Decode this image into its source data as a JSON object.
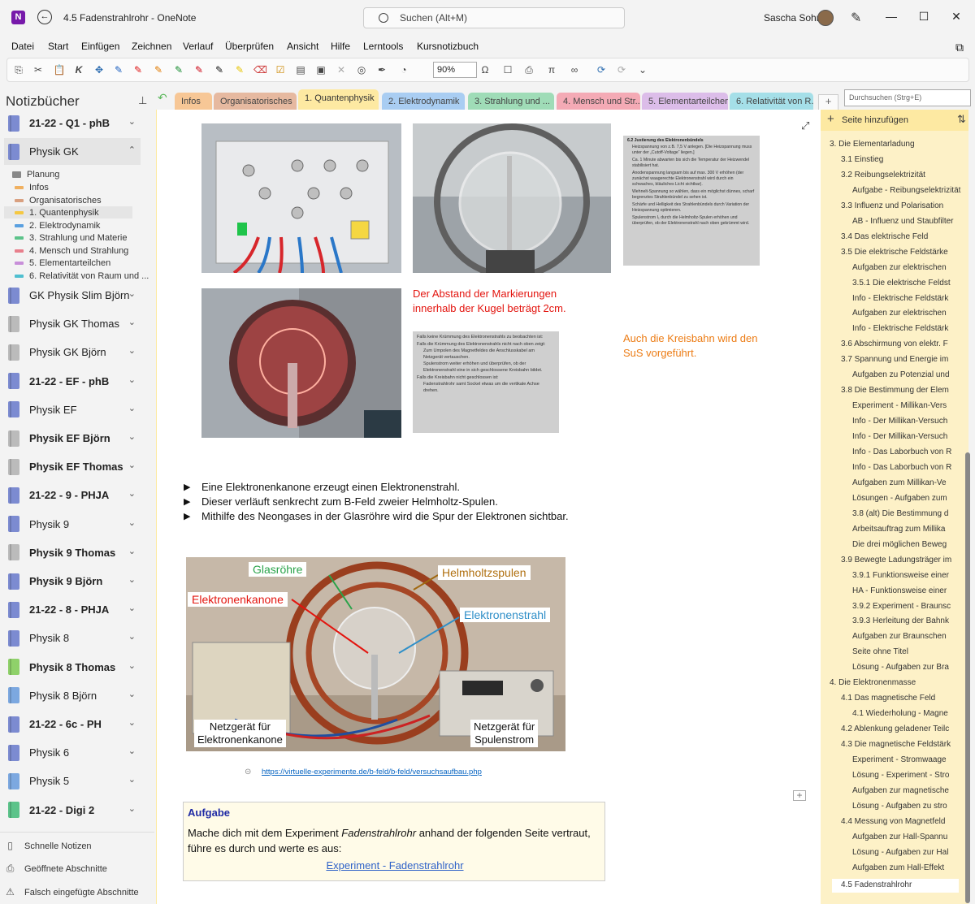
{
  "window": {
    "title": "4.5 Fadenstrahlrohr  -  OneNote",
    "search_placeholder": "Suchen (Alt+M)",
    "user": "Sascha Sohn"
  },
  "menu": [
    "Datei",
    "Start",
    "Einfügen",
    "Zeichnen",
    "Verlauf",
    "Überprüfen",
    "Ansicht",
    "Hilfe",
    "Lerntools",
    "Kursnotizbuch"
  ],
  "ribbon": {
    "zoom": "90%"
  },
  "sidebar": {
    "heading": "Notizbücher",
    "notebooks_top": [
      {
        "name": "21-22 - Q1 - phB",
        "bold": true,
        "color": "#7c8bd1"
      },
      {
        "name": "Physik GK",
        "bold": false,
        "color": "#7c8bd1",
        "expanded": true
      }
    ],
    "sections": [
      {
        "name": "Planung",
        "color": "#888"
      },
      {
        "name": "Infos",
        "color": "#f0b060"
      },
      {
        "name": "Organisatorisches",
        "color": "#d9a080"
      },
      {
        "name": "1. Quantenphysik",
        "color": "#f5c842"
      },
      {
        "name": "2. Elektrodynamik",
        "color": "#5aa0e0"
      },
      {
        "name": "3. Strahlung und Materie",
        "color": "#5cc38a"
      },
      {
        "name": "4. Mensch und Strahlung",
        "color": "#e87f8c"
      },
      {
        "name": "5. Elementarteilchen",
        "color": "#c88fd9"
      },
      {
        "name": "6. Relativität von Raum und ...",
        "color": "#4fbfd0"
      }
    ],
    "notebooks_bottom": [
      {
        "name": "GK Physik Slim Björn",
        "bold": false,
        "color": "#7c8bd1"
      },
      {
        "name": "Physik GK Thomas",
        "bold": false,
        "color": "#bbb"
      },
      {
        "name": "Physik GK Björn",
        "bold": false,
        "color": "#bbb"
      },
      {
        "name": "21-22 - EF - phB",
        "bold": true,
        "color": "#7c8bd1"
      },
      {
        "name": "Physik EF",
        "bold": false,
        "color": "#7c8bd1"
      },
      {
        "name": "Physik EF Björn",
        "bold": true,
        "color": "#bbb"
      },
      {
        "name": "Physik EF Thomas",
        "bold": true,
        "color": "#bbb"
      },
      {
        "name": "21-22 - 9 - PHJA",
        "bold": true,
        "color": "#7c8bd1"
      },
      {
        "name": "Physik 9",
        "bold": false,
        "color": "#7c8bd1"
      },
      {
        "name": "Physik 9 Thomas",
        "bold": true,
        "color": "#bbb"
      },
      {
        "name": "Physik 9 Björn",
        "bold": true,
        "color": "#7c8bd1"
      },
      {
        "name": "21-22 - 8 - PHJA",
        "bold": true,
        "color": "#7c8bd1"
      },
      {
        "name": "Physik 8",
        "bold": false,
        "color": "#7c8bd1"
      },
      {
        "name": "Physik 8 Thomas",
        "bold": true,
        "color": "#8fd16a"
      },
      {
        "name": "Physik 8 Björn",
        "bold": false,
        "color": "#7ca8e0"
      },
      {
        "name": "21-22 - 6c - PH",
        "bold": true,
        "color": "#7c8bd1"
      },
      {
        "name": "Physik 6",
        "bold": false,
        "color": "#7c8bd1"
      },
      {
        "name": "Physik 5",
        "bold": false,
        "color": "#7ca8e0"
      },
      {
        "name": "21-22 - Digi 2",
        "bold": true,
        "color": "#5cc38a"
      }
    ],
    "bottom_links": [
      "Schnelle Notizen",
      "Geöffnete Abschnitte",
      "Falsch eingefügte Abschnitte"
    ]
  },
  "section_tabs": [
    {
      "label": "Infos",
      "color": "#f7c796"
    },
    {
      "label": "Organisatorisches",
      "color": "#e6b9a0"
    },
    {
      "label": "1. Quantenphysik",
      "color": "#fde9a2"
    },
    {
      "label": "2. Elektrodynamik",
      "color": "#a9cdf2"
    },
    {
      "label": "3. Strahlung und ...",
      "color": "#9fdcb7"
    },
    {
      "label": "4. Mensch und Str...",
      "color": "#f4aab5"
    },
    {
      "label": "5. Elementarteilchen",
      "color": "#dcbde9"
    },
    {
      "label": "6. Relativität von R...",
      "color": "#a5dfe8"
    }
  ],
  "section_search": "Durchsuchen (Strg+E)",
  "page": {
    "doc_heading": "6.2  Justierung des Elektronenbündels",
    "doc_lines": [
      "Heizspannung von z.B. 7,5 V anlegen. [Die Heizspannung muss unter der „Cutoff-Voltage“ liegen.]",
      "Ca. 1 Minute abwarten bis sich die Temperatur der Heizwendel stabilisiert hat.",
      "Anodenspannung langsam bis auf max. 300 V erhöhen (der zunächst waagerechte Elektronenstrahl wird durch ein schwaches, bläuliches Licht sichtbar).",
      "Wehnelt-Spannung so wählen, dass ein möglichst dünnes, scharf begrenztes Strahlenbündel zu sehen ist.",
      "Schärfe und Helligkeit des Strahlenbündels durch Variation der Heizspannung optimieren.",
      "Spulenstrom I₁ durch die Helmholtz-Spulen erhöhen und überprüfen, ob der Elektronenstrahl nach oben gekrümmt wird."
    ],
    "doc2_lines": [
      "Falls keine Krümmung des Elektronenstrahls zu beobachten ist:",
      "Falls die Krümmung des Elektronenstrahls nicht nach oben zeigt:",
      "Zum Umpolen des Magnetfeldes die Anschlusskabel am Netzgerät vertauschen.",
      "Spulenstrom weiter erhöhen und überprüfen, ob der Elektronenstrahl eine in sich geschlossene Kreisbahn bildet.",
      "Falls die Kreisbahn nicht geschlossen ist:",
      "Fadenstrahlrohr samt Sockel etwas um die vertikale Achse drehen."
    ],
    "red_note": "Der Abstand der Markierungen innerhalb der Kugel beträgt 2cm.",
    "orange_note": "Auch die Kreisbahn wird den SuS vorgeführt.",
    "bullets": [
      "Eine Elektronenkanone erzeugt einen Elektronenstrahl.",
      "Dieser verläuft senkrecht zum B-Feld zweier Helmholtz-Spulen.",
      "Mithilfe des Neongases in der Glasröhre wird die Spur der Elektronen sichtbar."
    ],
    "diagram_labels": {
      "glas": "Glasröhre",
      "helm": "Helmholtzspulen",
      "kanone": "Elektronenkanone",
      "strahl": "Elektronenstrahl",
      "netz1a": "Netzgerät für",
      "netz1b": "Elektronenkanone",
      "netz2a": "Netzgerät für",
      "netz2b": "Spulenstrom"
    },
    "link": "https://virtuelle-experimente.de/b-feld/b-feld/versuchsaufbau.php",
    "task": {
      "title": "Aufgabe",
      "text_a": "Mache dich mit dem Experiment ",
      "text_em": "Fadenstrahlrohr",
      "text_b": " anhand der folgenden Seite vertraut, führe es durch und werte es aus:",
      "link": "Experiment - Fadenstrahlrohr"
    }
  },
  "pages_panel": {
    "add_label": "Seite hinzufügen",
    "items": [
      {
        "t": "3. Die Elementarladung",
        "lv": 1
      },
      {
        "t": "3.1 Einstieg",
        "lv": 2
      },
      {
        "t": "3.2 Reibungselektrizität",
        "lv": 2
      },
      {
        "t": "Aufgabe - Reibungselektrizität",
        "lv": 3
      },
      {
        "t": "3.3 Influenz und Polarisation",
        "lv": 2
      },
      {
        "t": "AB - Influenz und Staubfilter",
        "lv": 3
      },
      {
        "t": "3.4 Das elektrische Feld",
        "lv": 2
      },
      {
        "t": "3.5 Die elektrische Feldstärke",
        "lv": 2
      },
      {
        "t": "Aufgaben zur elektrischen",
        "lv": 3
      },
      {
        "t": "3.5.1 Die elektrische Feldst",
        "lv": 3
      },
      {
        "t": "Info - Elektrische Feldstärk",
        "lv": 3
      },
      {
        "t": "Aufgaben zur elektrischen",
        "lv": 3
      },
      {
        "t": "Info - Elektrische Feldstärk",
        "lv": 3
      },
      {
        "t": "3.6 Abschirmung von elektr. F",
        "lv": 2
      },
      {
        "t": "3.7 Spannung und Energie im",
        "lv": 2
      },
      {
        "t": "Aufgaben zu Potenzial und",
        "lv": 3
      },
      {
        "t": "3.8 Die Bestimmung der Elem",
        "lv": 2
      },
      {
        "t": "Experiment - Millikan-Vers",
        "lv": 3
      },
      {
        "t": "Info - Der Millikan-Versuch",
        "lv": 3
      },
      {
        "t": "Info - Der Millikan-Versuch",
        "lv": 3
      },
      {
        "t": "Info - Das Laborbuch von R",
        "lv": 3
      },
      {
        "t": "Info - Das Laborbuch von R",
        "lv": 3
      },
      {
        "t": "Aufgaben zum Millikan-Ve",
        "lv": 3
      },
      {
        "t": "Lösungen - Aufgaben zum",
        "lv": 3
      },
      {
        "t": "3.8 (alt) Die Bestimmung d",
        "lv": 3
      },
      {
        "t": "Arbeitsauftrag zum Millika",
        "lv": 3
      },
      {
        "t": "Die drei möglichen Beweg",
        "lv": 3
      },
      {
        "t": "3.9 Bewegte Ladungsträger im",
        "lv": 2
      },
      {
        "t": "3.9.1 Funktionsweise einer",
        "lv": 3
      },
      {
        "t": "HA - Funktionsweise einer",
        "lv": 3
      },
      {
        "t": "3.9.2 Experiment - Braunsc",
        "lv": 3
      },
      {
        "t": "3.9.3 Herleitung der Bahnk",
        "lv": 3
      },
      {
        "t": "Aufgaben zur Braunschen",
        "lv": 3
      },
      {
        "t": "Seite ohne Titel",
        "lv": 3
      },
      {
        "t": "Lösung - Aufgaben zur Bra",
        "lv": 3
      },
      {
        "t": "4. Die Elektronenmasse",
        "lv": 1
      },
      {
        "t": "4.1 Das magnetische Feld",
        "lv": 2
      },
      {
        "t": "4.1 Wiederholung - Magne",
        "lv": 3
      },
      {
        "t": "4.2 Ablenkung geladener Teilc",
        "lv": 2
      },
      {
        "t": "4.3 Die magnetische Feldstärk",
        "lv": 2
      },
      {
        "t": "Experiment - Stromwaage",
        "lv": 3
      },
      {
        "t": "Lösung - Experiment - Stro",
        "lv": 3
      },
      {
        "t": "Aufgaben zur magnetische",
        "lv": 3
      },
      {
        "t": "Lösung - Aufgaben zu stro",
        "lv": 3
      },
      {
        "t": "4.4 Messung von Magnetfeld",
        "lv": 2
      },
      {
        "t": "Aufgaben zur Hall-Spannu",
        "lv": 3
      },
      {
        "t": "Lösung - Aufgaben zur Hal",
        "lv": 3
      },
      {
        "t": "Aufgaben zum Hall-Effekt",
        "lv": 3
      },
      {
        "t": "4.5 Fadenstrahlrohr",
        "lv": 2,
        "active": true
      }
    ]
  }
}
